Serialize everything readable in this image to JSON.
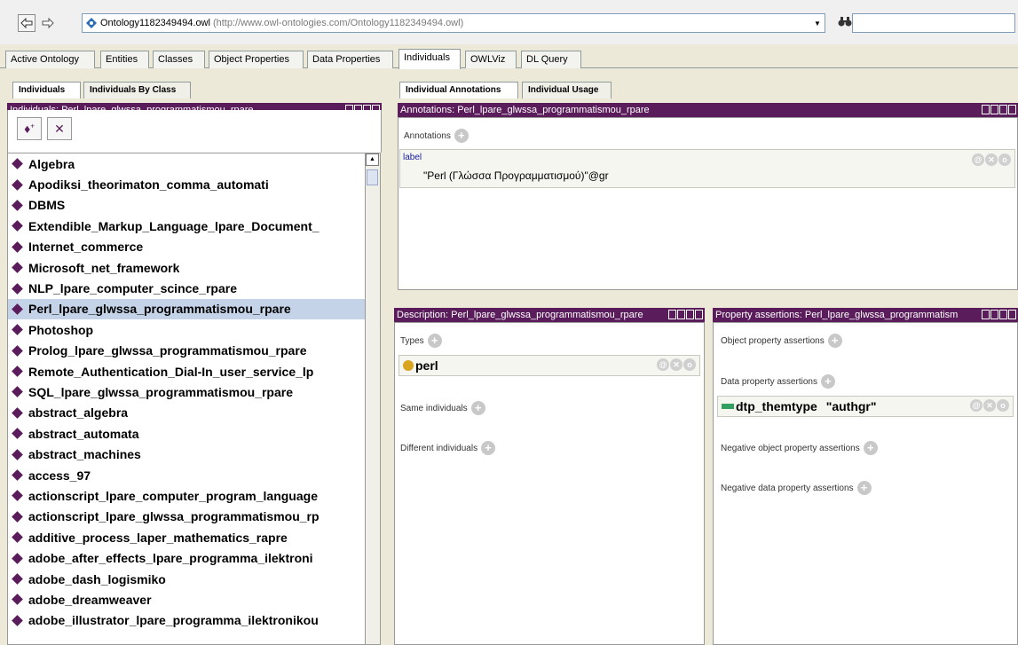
{
  "address_bar": {
    "back_icon": "left-arrow-icon",
    "forward_icon": "right-arrow-icon",
    "ontology_name": "Ontology1182349494.owl",
    "ontology_url": "(http://www.owl-ontologies.com/Ontology1182349494.owl)",
    "find_icon": "binoculars-icon",
    "search_value": ""
  },
  "main_tabs": [
    "Active Ontology",
    "Entities",
    "Classes",
    "Object Properties",
    "Data Properties",
    "Individuals",
    "OWLViz",
    "DL Query"
  ],
  "active_main_tab": "Individuals",
  "left": {
    "tabs": [
      "Individuals",
      "Individuals By Class"
    ],
    "header": "Individuals: Perl_lpare_glwssa_programmatismou_rpare",
    "items": [
      "Algebra",
      "Apodiksi_theorimaton_comma_automati",
      "DBMS",
      "Extendible_Markup_Language_lpare_Document_",
      "Internet_commerce",
      "Microsoft_net_framework",
      "NLP_lpare_computer_scince_rpare",
      "Perl_lpare_glwssa_programmatismou_rpare",
      "Photoshop",
      "Prolog_lpare_glwssa_programmatismou_rpare",
      "Remote_Authentication_Dial-In_user_service_lp",
      "SQL_lpare_glwssa_programmatismou_rpare",
      "abstract_algebra",
      "abstract_automata",
      "abstract_machines",
      "access_97",
      "actionscript_lpare_computer_program_language",
      "actionscript_lpare_glwssa_programmatismou_rp",
      "additive_process_laper_mathematics_rapre",
      "adobe_after_effects_lpare_programma_ilektroni",
      "adobe_dash_logismiko",
      "adobe_dreamweaver",
      "adobe_illustrator_lpare_programma_ilektronikou"
    ],
    "selected_index": 7
  },
  "annotations": {
    "tabs": [
      "Individual Annotations",
      "Individual Usage"
    ],
    "header": "Annotations: Perl_lpare_glwssa_programmatismou_rpare",
    "section_label": "Annotations",
    "label_key": "label",
    "label_value": "\"Perl (Γλώσσα Προγραμματισμού)\"@gr"
  },
  "description": {
    "header": "Description: Perl_lpare_glwssa_programmatismou_rpare",
    "types_label": "Types",
    "type_value": "perl",
    "same_label": "Same individuals",
    "different_label": "Different individuals"
  },
  "property_assertions": {
    "header": "Property assertions: Perl_lpare_glwssa_programmatism",
    "object_label": "Object property assertions",
    "data_label": "Data property assertions",
    "data_property": "dtp_themtype",
    "data_value": "\"authgr\"",
    "neg_object_label": "Negative object property assertions",
    "neg_data_label": "Negative data property assertions"
  }
}
